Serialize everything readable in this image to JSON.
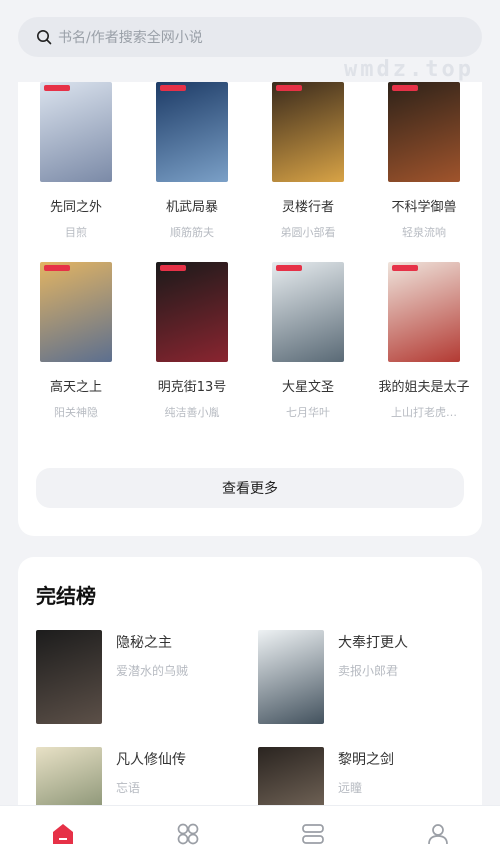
{
  "search": {
    "placeholder": "书名/作者搜索全网小说"
  },
  "watermark": "wmdz.top",
  "books": [
    {
      "title": "先同之外",
      "author": "目煎",
      "colors": [
        "#dbe3ee",
        "#7b8aa7"
      ],
      "art": ""
    },
    {
      "title": "机武局暴",
      "author": "顺筋筋夫",
      "colors": [
        "#1d3b66",
        "#7ba0c7"
      ],
      "art": ""
    },
    {
      "title": "灵楼行者",
      "author": "弟圆小部看",
      "colors": [
        "#3a2a1c",
        "#d8a346"
      ],
      "art": ""
    },
    {
      "title": "不科学御兽",
      "author": "轻泉流响",
      "colors": [
        "#2d2219",
        "#a0542c"
      ],
      "art": ""
    },
    {
      "title": "高天之上",
      "author": "阳关神隐",
      "colors": [
        "#e2b463",
        "#5c6f8f"
      ],
      "art": ""
    },
    {
      "title": "明克街13号",
      "author": "纯洁善小胤",
      "colors": [
        "#1a1a1a",
        "#8a2530"
      ],
      "art": ""
    },
    {
      "title": "大星文圣",
      "author": "七月华叶",
      "colors": [
        "#e6ebee",
        "#5a6a76"
      ],
      "art": ""
    },
    {
      "title": "我的姐夫是太子",
      "author": "上山打老虎…",
      "colors": [
        "#efe4dc",
        "#b33a33"
      ],
      "art": ""
    }
  ],
  "more_label": "查看更多",
  "finished": {
    "title": "完结榜",
    "items": [
      {
        "title": "隐秘之主",
        "author": "爱潜水的乌贼",
        "colors": [
          "#1c1c1c",
          "#5c5048"
        ]
      },
      {
        "title": "大奉打更人",
        "author": "卖报小郎君",
        "colors": [
          "#eef2f4",
          "#43525e"
        ]
      },
      {
        "title": "凡人修仙传",
        "author": "忘语",
        "colors": [
          "#e8e1c6",
          "#6b7a5a"
        ]
      },
      {
        "title": "黎明之剑",
        "author": "远瞳",
        "colors": [
          "#2a2420",
          "#8a7a6a"
        ]
      }
    ]
  },
  "tabs": [
    {
      "name": "home",
      "active": true
    },
    {
      "name": "category",
      "active": false
    },
    {
      "name": "bookshelf",
      "active": false
    },
    {
      "name": "profile",
      "active": false
    }
  ],
  "colors": {
    "accent": "#e63147",
    "inactive": "#9b9fa6"
  }
}
